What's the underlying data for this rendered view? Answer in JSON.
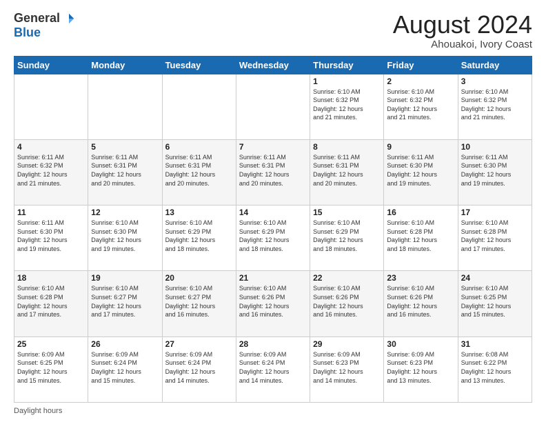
{
  "header": {
    "logo_general": "General",
    "logo_blue": "Blue",
    "title": "August 2024",
    "location": "Ahouakoi, Ivory Coast"
  },
  "days_of_week": [
    "Sunday",
    "Monday",
    "Tuesday",
    "Wednesday",
    "Thursday",
    "Friday",
    "Saturday"
  ],
  "weeks": [
    [
      {
        "day": "",
        "info": ""
      },
      {
        "day": "",
        "info": ""
      },
      {
        "day": "",
        "info": ""
      },
      {
        "day": "",
        "info": ""
      },
      {
        "day": "1",
        "info": "Sunrise: 6:10 AM\nSunset: 6:32 PM\nDaylight: 12 hours\nand 21 minutes."
      },
      {
        "day": "2",
        "info": "Sunrise: 6:10 AM\nSunset: 6:32 PM\nDaylight: 12 hours\nand 21 minutes."
      },
      {
        "day": "3",
        "info": "Sunrise: 6:10 AM\nSunset: 6:32 PM\nDaylight: 12 hours\nand 21 minutes."
      }
    ],
    [
      {
        "day": "4",
        "info": "Sunrise: 6:11 AM\nSunset: 6:32 PM\nDaylight: 12 hours\nand 21 minutes."
      },
      {
        "day": "5",
        "info": "Sunrise: 6:11 AM\nSunset: 6:31 PM\nDaylight: 12 hours\nand 20 minutes."
      },
      {
        "day": "6",
        "info": "Sunrise: 6:11 AM\nSunset: 6:31 PM\nDaylight: 12 hours\nand 20 minutes."
      },
      {
        "day": "7",
        "info": "Sunrise: 6:11 AM\nSunset: 6:31 PM\nDaylight: 12 hours\nand 20 minutes."
      },
      {
        "day": "8",
        "info": "Sunrise: 6:11 AM\nSunset: 6:31 PM\nDaylight: 12 hours\nand 20 minutes."
      },
      {
        "day": "9",
        "info": "Sunrise: 6:11 AM\nSunset: 6:30 PM\nDaylight: 12 hours\nand 19 minutes."
      },
      {
        "day": "10",
        "info": "Sunrise: 6:11 AM\nSunset: 6:30 PM\nDaylight: 12 hours\nand 19 minutes."
      }
    ],
    [
      {
        "day": "11",
        "info": "Sunrise: 6:11 AM\nSunset: 6:30 PM\nDaylight: 12 hours\nand 19 minutes."
      },
      {
        "day": "12",
        "info": "Sunrise: 6:10 AM\nSunset: 6:30 PM\nDaylight: 12 hours\nand 19 minutes."
      },
      {
        "day": "13",
        "info": "Sunrise: 6:10 AM\nSunset: 6:29 PM\nDaylight: 12 hours\nand 18 minutes."
      },
      {
        "day": "14",
        "info": "Sunrise: 6:10 AM\nSunset: 6:29 PM\nDaylight: 12 hours\nand 18 minutes."
      },
      {
        "day": "15",
        "info": "Sunrise: 6:10 AM\nSunset: 6:29 PM\nDaylight: 12 hours\nand 18 minutes."
      },
      {
        "day": "16",
        "info": "Sunrise: 6:10 AM\nSunset: 6:28 PM\nDaylight: 12 hours\nand 18 minutes."
      },
      {
        "day": "17",
        "info": "Sunrise: 6:10 AM\nSunset: 6:28 PM\nDaylight: 12 hours\nand 17 minutes."
      }
    ],
    [
      {
        "day": "18",
        "info": "Sunrise: 6:10 AM\nSunset: 6:28 PM\nDaylight: 12 hours\nand 17 minutes."
      },
      {
        "day": "19",
        "info": "Sunrise: 6:10 AM\nSunset: 6:27 PM\nDaylight: 12 hours\nand 17 minutes."
      },
      {
        "day": "20",
        "info": "Sunrise: 6:10 AM\nSunset: 6:27 PM\nDaylight: 12 hours\nand 16 minutes."
      },
      {
        "day": "21",
        "info": "Sunrise: 6:10 AM\nSunset: 6:26 PM\nDaylight: 12 hours\nand 16 minutes."
      },
      {
        "day": "22",
        "info": "Sunrise: 6:10 AM\nSunset: 6:26 PM\nDaylight: 12 hours\nand 16 minutes."
      },
      {
        "day": "23",
        "info": "Sunrise: 6:10 AM\nSunset: 6:26 PM\nDaylight: 12 hours\nand 16 minutes."
      },
      {
        "day": "24",
        "info": "Sunrise: 6:10 AM\nSunset: 6:25 PM\nDaylight: 12 hours\nand 15 minutes."
      }
    ],
    [
      {
        "day": "25",
        "info": "Sunrise: 6:09 AM\nSunset: 6:25 PM\nDaylight: 12 hours\nand 15 minutes."
      },
      {
        "day": "26",
        "info": "Sunrise: 6:09 AM\nSunset: 6:24 PM\nDaylight: 12 hours\nand 15 minutes."
      },
      {
        "day": "27",
        "info": "Sunrise: 6:09 AM\nSunset: 6:24 PM\nDaylight: 12 hours\nand 14 minutes."
      },
      {
        "day": "28",
        "info": "Sunrise: 6:09 AM\nSunset: 6:24 PM\nDaylight: 12 hours\nand 14 minutes."
      },
      {
        "day": "29",
        "info": "Sunrise: 6:09 AM\nSunset: 6:23 PM\nDaylight: 12 hours\nand 14 minutes."
      },
      {
        "day": "30",
        "info": "Sunrise: 6:09 AM\nSunset: 6:23 PM\nDaylight: 12 hours\nand 13 minutes."
      },
      {
        "day": "31",
        "info": "Sunrise: 6:08 AM\nSunset: 6:22 PM\nDaylight: 12 hours\nand 13 minutes."
      }
    ]
  ],
  "footer": {
    "daylight_label": "Daylight hours"
  }
}
